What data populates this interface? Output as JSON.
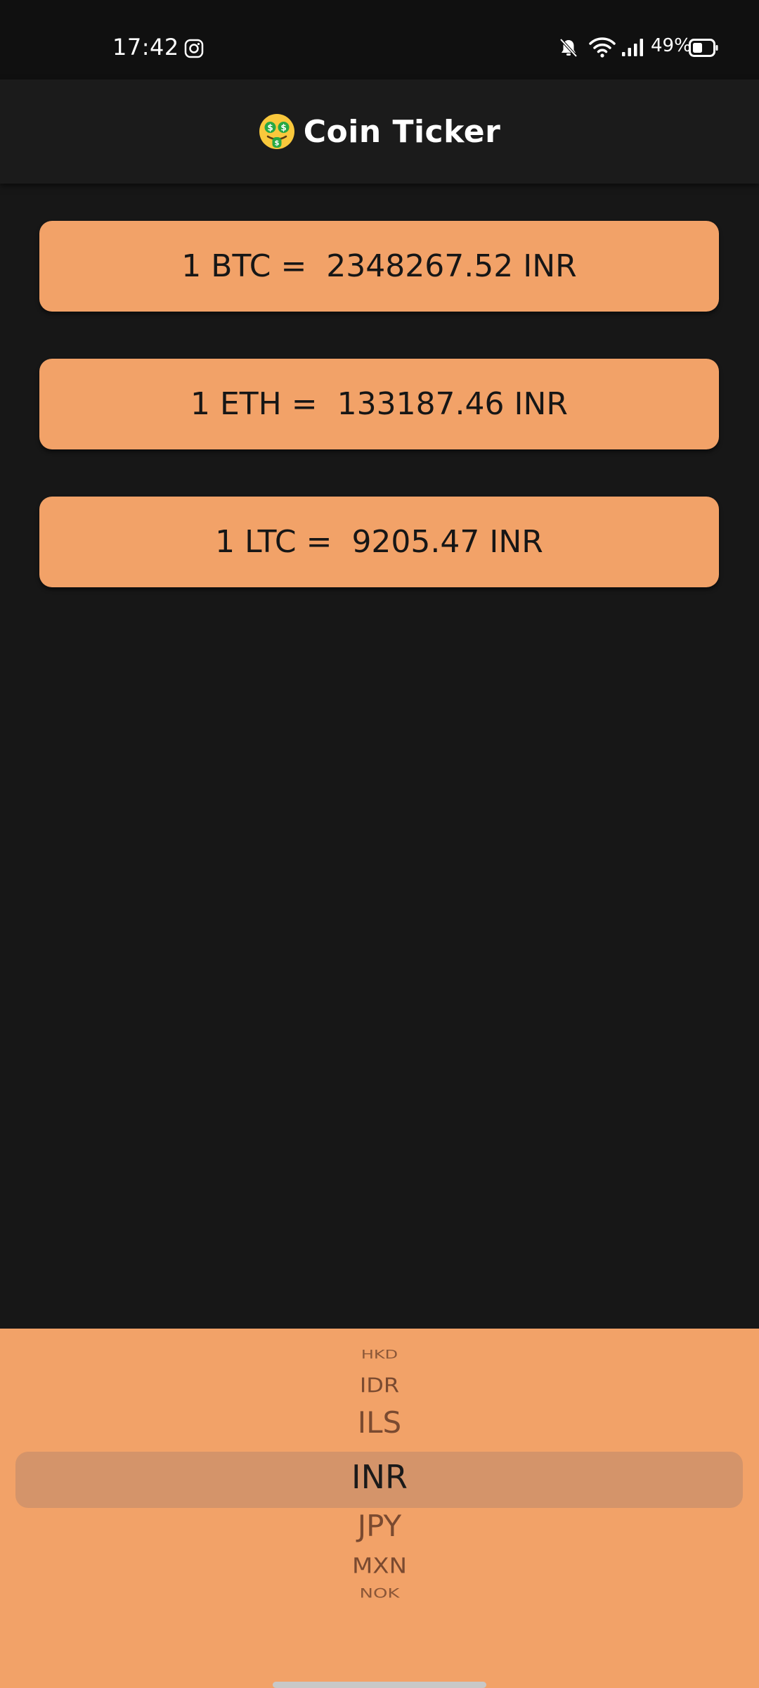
{
  "status_bar": {
    "time": "17:42",
    "battery_text": "49%",
    "icons": [
      "instagram-icon",
      "bell-off-icon",
      "wifi-icon",
      "signal-icon",
      "battery-icon"
    ]
  },
  "app_bar": {
    "emoji_icon": "money-mouth-face-icon",
    "title": "Coin Ticker"
  },
  "rates": [
    {
      "text": "1 BTC =  2348267.52 INR"
    },
    {
      "text": "1 ETH =  133187.46 INR"
    },
    {
      "text": "1 LTC =  9205.47 INR"
    }
  ],
  "currency_picker": {
    "items": [
      "HKD",
      "IDR",
      "ILS",
      "INR",
      "JPY",
      "MXN",
      "NOK"
    ],
    "selected": "INR"
  },
  "colors": {
    "background": "#171717",
    "status_bar": "#101010",
    "app_bar": "#1b1b1b",
    "card": "#f2a268",
    "picker_highlight": "#d4946a"
  }
}
